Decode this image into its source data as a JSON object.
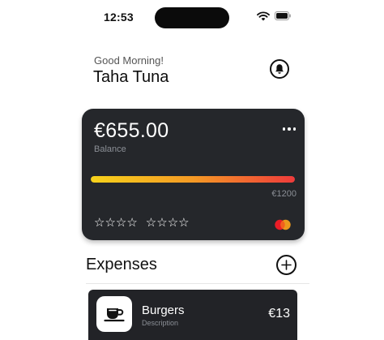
{
  "status_bar": {
    "time": "12:53"
  },
  "header": {
    "greeting": "Good Morning!",
    "user_name": "Taha Tuna"
  },
  "card": {
    "amount": "€655.00",
    "balance_label": "Balance",
    "limit": "€1200",
    "spent_fraction": 1.0,
    "masked_number": [
      "☆☆☆☆",
      "☆☆☆☆"
    ],
    "gradient": [
      "#f7d21b",
      "#f59a25",
      "#ef3b3b"
    ]
  },
  "expenses": {
    "title": "Expenses",
    "items": [
      {
        "name": "Burgers",
        "description": "Description",
        "amount": "€13",
        "icon": "coffee-cup-icon"
      }
    ]
  },
  "colors": {
    "card_bg": "#25272b",
    "row_bg": "#222327",
    "muted": "#8b8f96",
    "mastercard_red": "#eb1c26",
    "mastercard_orange": "#f79e1b"
  }
}
